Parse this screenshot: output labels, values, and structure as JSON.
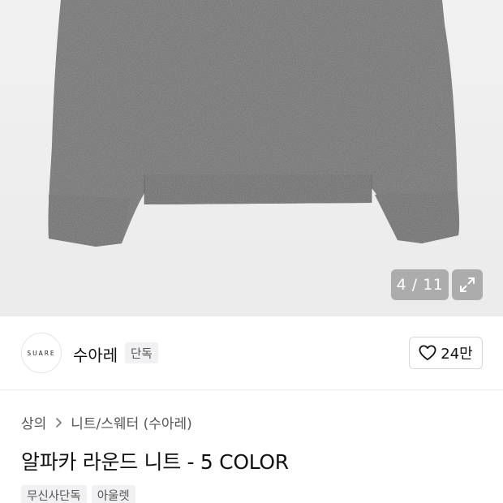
{
  "gallery": {
    "current": "4",
    "separator": "/",
    "total": "11",
    "counter_text": "4 / 11"
  },
  "brand": {
    "logo_text": "SUARE",
    "name": "수아레",
    "badge": "단독"
  },
  "like": {
    "count": "24만"
  },
  "breadcrumb": {
    "items": [
      "상의",
      "니트/스웨터 (수아레)"
    ]
  },
  "product": {
    "title": "알파카 라운드 니트 - 5 COLOR"
  },
  "tags": [
    "무신사단독",
    "아울렛"
  ],
  "icons": {
    "expand": "expand-icon",
    "heart": "heart-icon",
    "chevron": "chevron-right-icon"
  },
  "colors": {
    "sweater": "#6c6c6c",
    "background": "#eeeeee"
  }
}
